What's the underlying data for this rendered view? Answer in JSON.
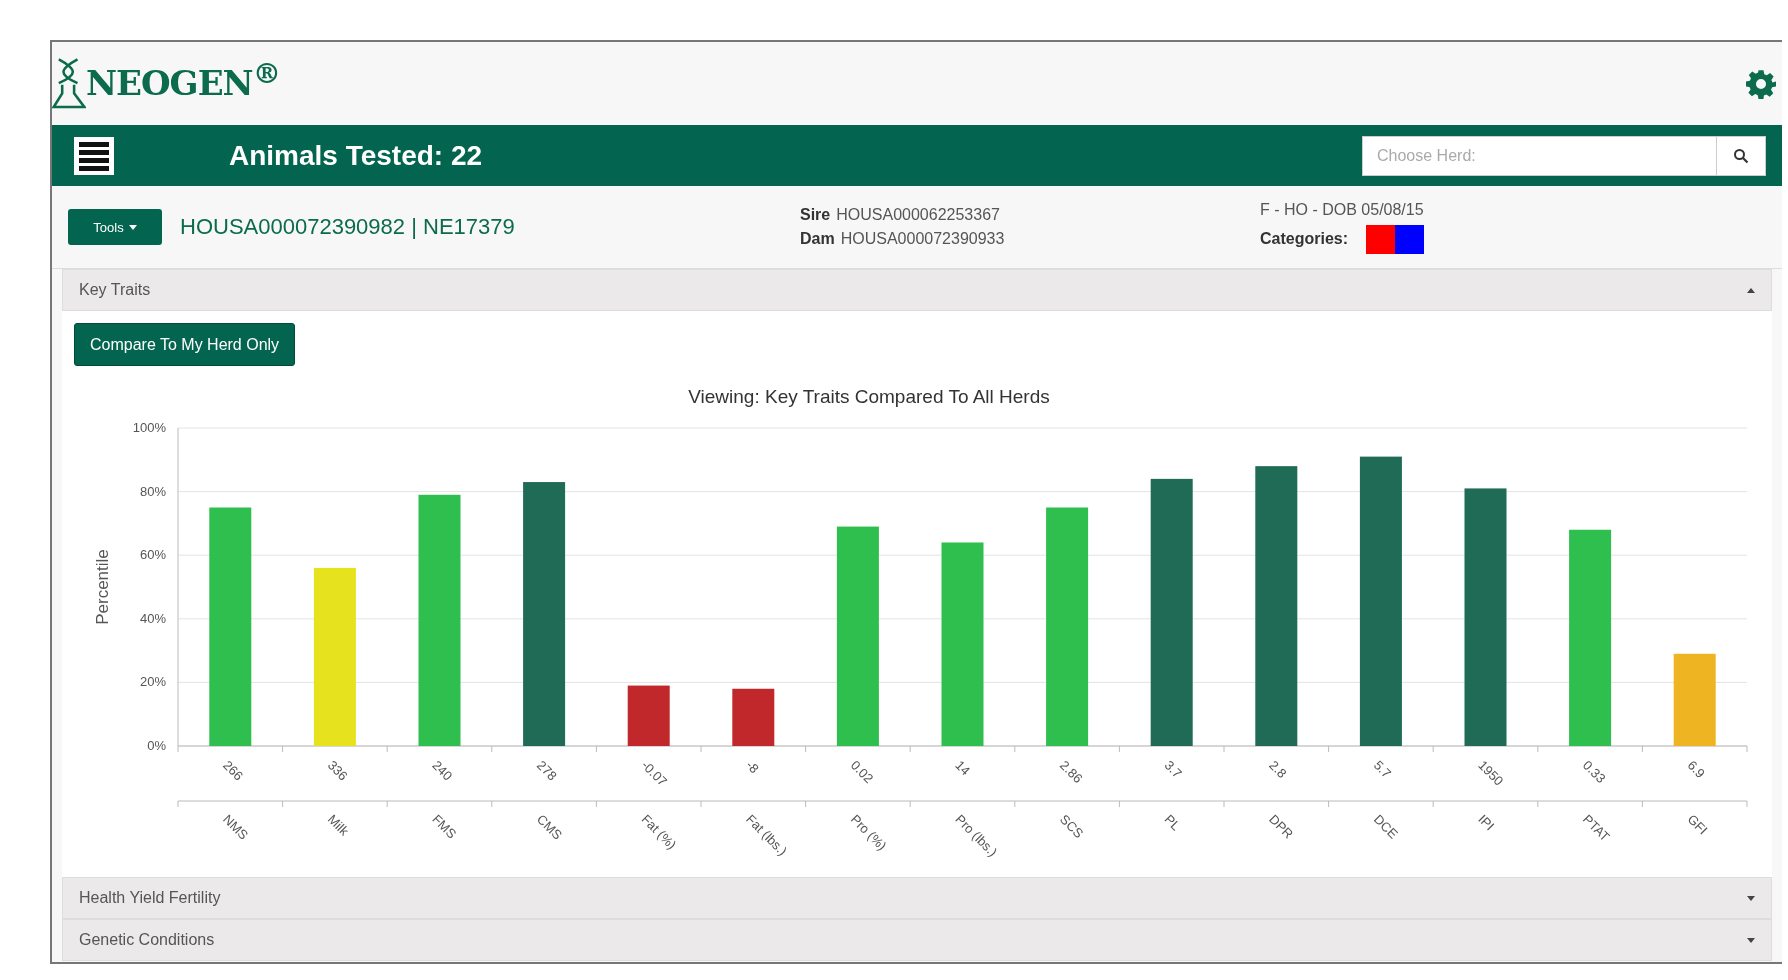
{
  "header": {
    "logo": "NEOGEN$^{®}$"
  },
  "toolbar": {
    "title": "Animals Tested: 22",
    "search": {
      "placeholder": "Choose Herd:"
    }
  },
  "animal": {
    "tools_button": "Tools",
    "id": "HOUSA000072390982 | NE17379",
    "sire_label": "Sire",
    "sire": "HOUSA000062253367",
    "dam_label": "Dam",
    "dam": "HOUSA000072390933",
    "summary": "F - HO - DOB 05/08/15",
    "categories_label": "Categories:",
    "categories": [
      {
        "color": "#ff0000"
      },
      {
        "color": "#0000ff"
      }
    ]
  },
  "sections": [
    {
      "title": "Key Traits",
      "expanded": true
    },
    {
      "title": "Health Yield Fertility",
      "expanded": false
    },
    {
      "title": "Genetic Conditions",
      "expanded": false
    }
  ],
  "key_traits": {
    "compare_button": "Compare To My Herd Only",
    "bars": [
      {
        "color": "#2ebf4f"
      },
      {
        "color": "#e6e21e"
      },
      {
        "color": "#2ebf4f"
      },
      {
        "color": "#1f6b55"
      },
      {
        "color": "#c0282c"
      },
      {
        "color": "#c0282c"
      },
      {
        "color": "#2ebf4f"
      },
      {
        "color": "#2ebf4f"
      },
      {
        "color": "#2ebf4f"
      },
      {
        "color": "#1f6b55"
      },
      {
        "color": "#1f6b55"
      },
      {
        "color": "#1f6b55"
      },
      {
        "color": "#1f6b55"
      },
      {
        "color": "#2ebf4f"
      },
      {
        "color": "#efb421"
      }
    ],
    "chart_data": {
      "type": "bar",
      "title": "Viewing: Key Traits Compared To All Herds",
      "ylabel": "Percentile",
      "categories": [
        "NMS",
        "Milk",
        "FMS",
        "CMS",
        "Fat (%)",
        "Fat (lbs.)",
        "Pro (%)",
        "Pro (lbs.)",
        "SCS",
        "PL",
        "DPR",
        "DCE",
        "IPI",
        "PTAT",
        "GFI"
      ],
      "value_labels": [
        "266",
        "336",
        "240",
        "278",
        "-0.07",
        "-8",
        "0.02",
        "14",
        "2.86",
        "3.7",
        "2.8",
        "5.7",
        "1950",
        "0.33",
        "6.9"
      ],
      "grid": true,
      "series": [
        {
          "values": [
            75,
            56,
            79,
            83,
            19,
            18,
            69,
            64,
            75,
            84,
            88,
            91,
            81,
            68,
            29
          ]
        }
      ],
      "ylim": [
        0,
        100
      ],
      "yticks": [
        {
          "value": 0,
          "label": "0%"
        },
        {
          "value": 20,
          "label": "20%"
        },
        {
          "value": 40,
          "label": "40%"
        },
        {
          "value": 60,
          "label": "60%"
        },
        {
          "value": 80,
          "label": "80%"
        },
        {
          "value": 100,
          "label": "100%"
        }
      ]
    }
  }
}
